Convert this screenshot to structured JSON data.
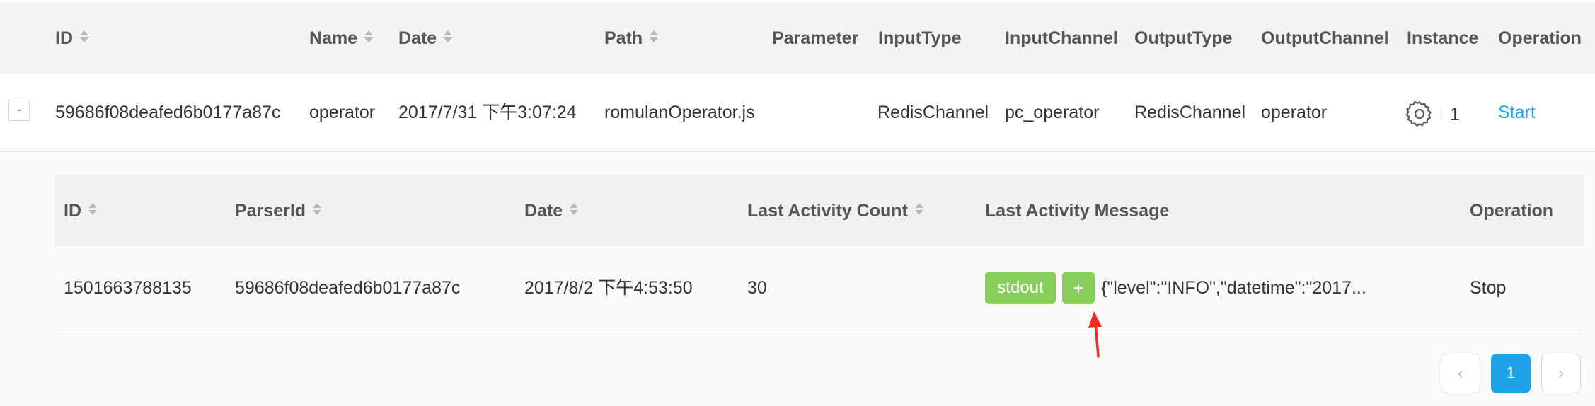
{
  "outer_table": {
    "columns": {
      "id": "ID",
      "name": "Name",
      "date": "Date",
      "path": "Path",
      "parameter": "Parameter",
      "input_type": "InputType",
      "input_channel": "InputChannel",
      "output_type": "OutputType",
      "output_channel": "OutputChannel",
      "instance": "Instance",
      "operation": "Operation"
    },
    "row": {
      "expand_symbol": "-",
      "id": "59686f08deafed6b0177a87c",
      "name": "operator",
      "date": "2017/7/31 下午3:07:24",
      "path": "romulanOperator.js",
      "parameter": "",
      "input_type": "RedisChannel",
      "input_channel": "pc_operator",
      "output_type": "RedisChannel",
      "output_channel": "operator",
      "instance_separator": "|",
      "instance_count": "1",
      "operation": "Start"
    }
  },
  "inner_table": {
    "columns": {
      "id": "ID",
      "parser_id": "ParserId",
      "date": "Date",
      "last_activity_count": "Last Activity Count",
      "last_activity_message": "Last Activity Message",
      "operation": "Operation"
    },
    "row": {
      "id": "1501663788135",
      "parser_id": "59686f08deafed6b0177a87c",
      "date": "2017/8/2 下午4:53:50",
      "last_activity_count": "30",
      "tag": "stdout",
      "expand_button": "+",
      "message": "{\"level\":\"INFO\",\"datetime\":\"2017...",
      "operation": "Stop"
    }
  },
  "pagination": {
    "prev": "‹",
    "current_page": "1",
    "next": "›"
  },
  "colors": {
    "link": "#1fa3e8",
    "tag_green": "#87cf5a",
    "annotation_arrow": "#f02b1f"
  }
}
